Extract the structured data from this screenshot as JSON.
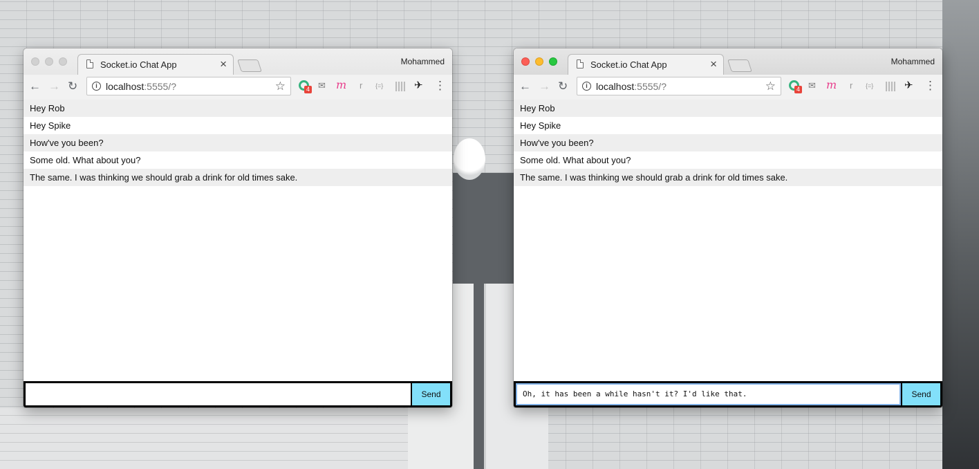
{
  "windows": [
    {
      "tab_title": "Socket.io Chat App",
      "profile_name": "Mohammed",
      "url_host": "localhost",
      "url_rest": ":5555/?",
      "extension_badge": "4",
      "messages": [
        "Hey Rob",
        "Hey Spike",
        "How've you been?",
        "Some old. What about you?",
        "The same. I was thinking we should grab a drink for old times sake."
      ],
      "input_value": "",
      "send_label": "Send"
    },
    {
      "tab_title": "Socket.io Chat App",
      "profile_name": "Mohammed",
      "url_host": "localhost",
      "url_rest": ":5555/?",
      "extension_badge": "4",
      "messages": [
        "Hey Rob",
        "Hey Spike",
        "How've you been?",
        "Some old. What about you?",
        "The same. I was thinking we should grab a drink for old times sake."
      ],
      "input_value": "Oh, it has been a while hasn't it? I'd like that.",
      "send_label": "Send"
    }
  ],
  "icons": {
    "back": "←",
    "forward": "→",
    "reload": "↻",
    "info": "i",
    "star": "☆",
    "close_tab": "×",
    "menu": "⋮",
    "ext_m": "m",
    "ext_r": "r",
    "ext_json": "{=}",
    "ext_bird": "✈"
  },
  "colors": {
    "send_button": "#82e0fa",
    "form_bar": "#000000",
    "alt_row": "#eeeeee"
  }
}
